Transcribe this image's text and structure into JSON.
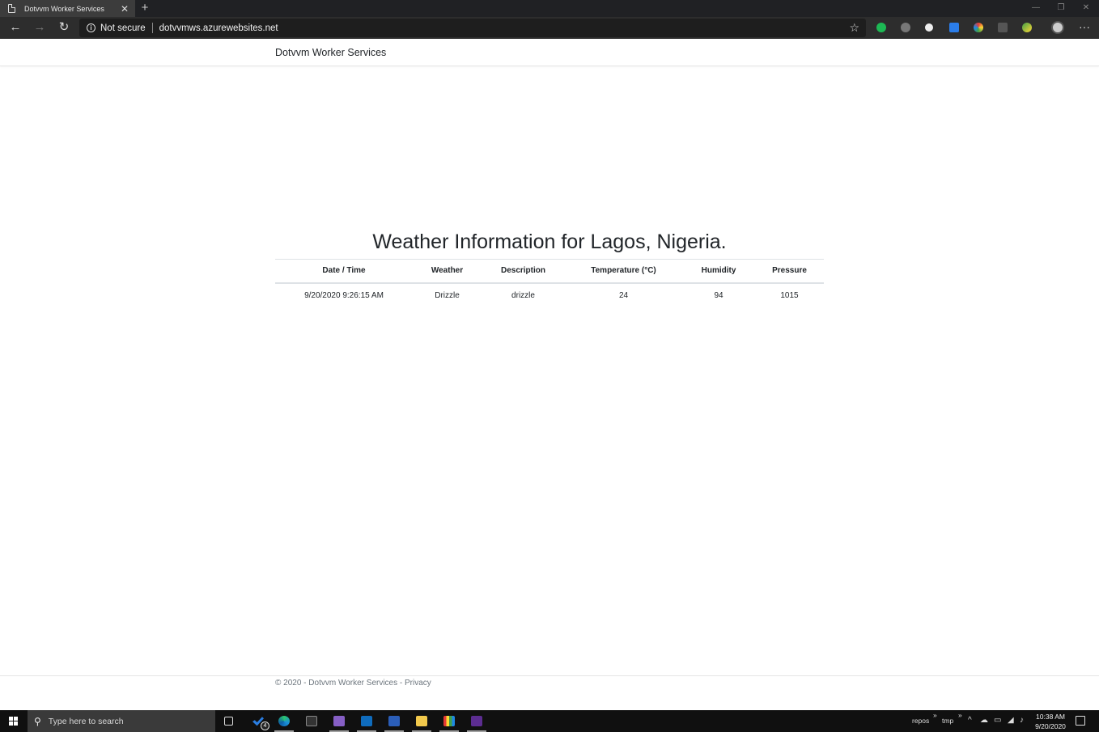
{
  "browser": {
    "tab_title": "Dotvvm Worker Services",
    "security_label": "Not secure",
    "url": "dotvvmws.azurewebsites.net"
  },
  "site": {
    "brand": "Dotvvm Worker Services"
  },
  "main": {
    "title": "Weather Information for Lagos, Nigeria.",
    "columns": [
      "Date / Time",
      "Weather",
      "Description",
      "Temperature (°C)",
      "Humidity",
      "Pressure"
    ],
    "rows": [
      [
        "9/20/2020 9:26:15 AM",
        "Drizzle",
        "drizzle",
        "24",
        "94",
        "1015"
      ]
    ]
  },
  "footer": {
    "copyright": "© 2020 - Dotvvm Worker Services - ",
    "privacy_link": "Privacy"
  },
  "taskbar": {
    "search_placeholder": "Type here to search",
    "todo_badge": "4",
    "tray_folder_1": "repos",
    "tray_folder_2": "tmp",
    "time": "10:38 AM",
    "date": "9/20/2020"
  },
  "colors": {
    "text": "#212529",
    "muted": "#6c757d",
    "border": "#dee2e6",
    "taskbar": "#101010",
    "browser_chrome": "#2d2d2d"
  }
}
